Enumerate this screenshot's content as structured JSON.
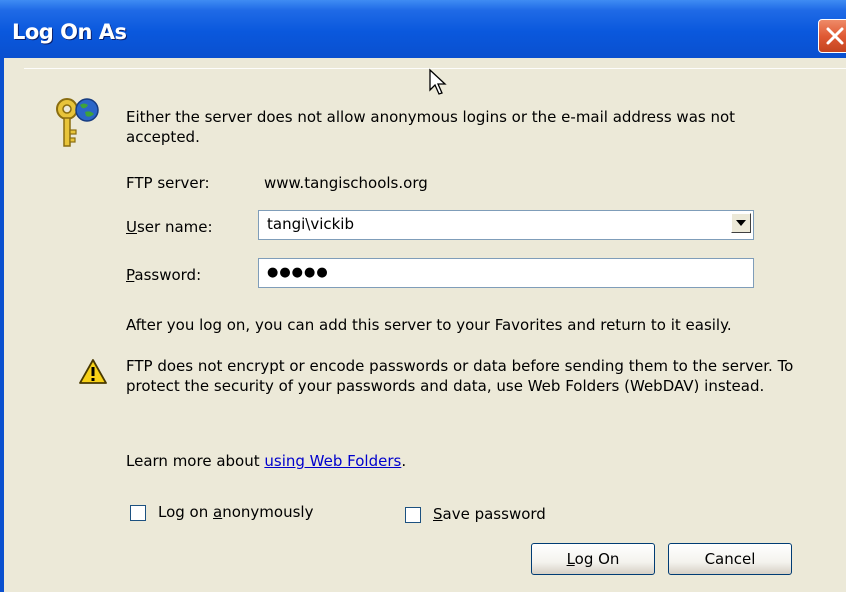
{
  "window": {
    "title": "Log On As",
    "close_icon": "close-icon"
  },
  "message": {
    "icon": "key-globe-icon",
    "text": "Either the server does not allow anonymous logins or the e-mail address was not accepted."
  },
  "ftp_server": {
    "label": "FTP server:",
    "value": "www.tangischools.org"
  },
  "user_name": {
    "label_mnemonic": "U",
    "label_rest": "ser name:",
    "value": "tangi\\vickib",
    "dropdown_icon": "chevron-down-icon"
  },
  "password": {
    "label_mnemonic": "P",
    "label_rest": "assword:",
    "value": "●●●●●"
  },
  "favorites_note": "After you log on, you can add this server to your Favorites and return to it easily.",
  "warning": {
    "icon": "warning-icon",
    "text": "FTP does not encrypt or encode passwords or data before sending them to the server.  To protect the security of your passwords and data, use Web Folders (WebDAV) instead."
  },
  "learn_more": {
    "prefix": "Learn more about ",
    "link": "using Web Folders",
    "suffix": "."
  },
  "options": {
    "anonymous": {
      "pre": "Log on ",
      "mnemonic": "a",
      "post": "nonymously",
      "checked": false
    },
    "save_password": {
      "mnemonic": "S",
      "post": "ave password",
      "checked": false
    }
  },
  "buttons": {
    "logon": {
      "mnemonic": "L",
      "post": "og On"
    },
    "cancel": "Cancel"
  },
  "colors": {
    "title_bar": "#0a58dd",
    "dialog_bg": "#ece9d8",
    "link": "#0000cc",
    "close": "#e05a34"
  }
}
